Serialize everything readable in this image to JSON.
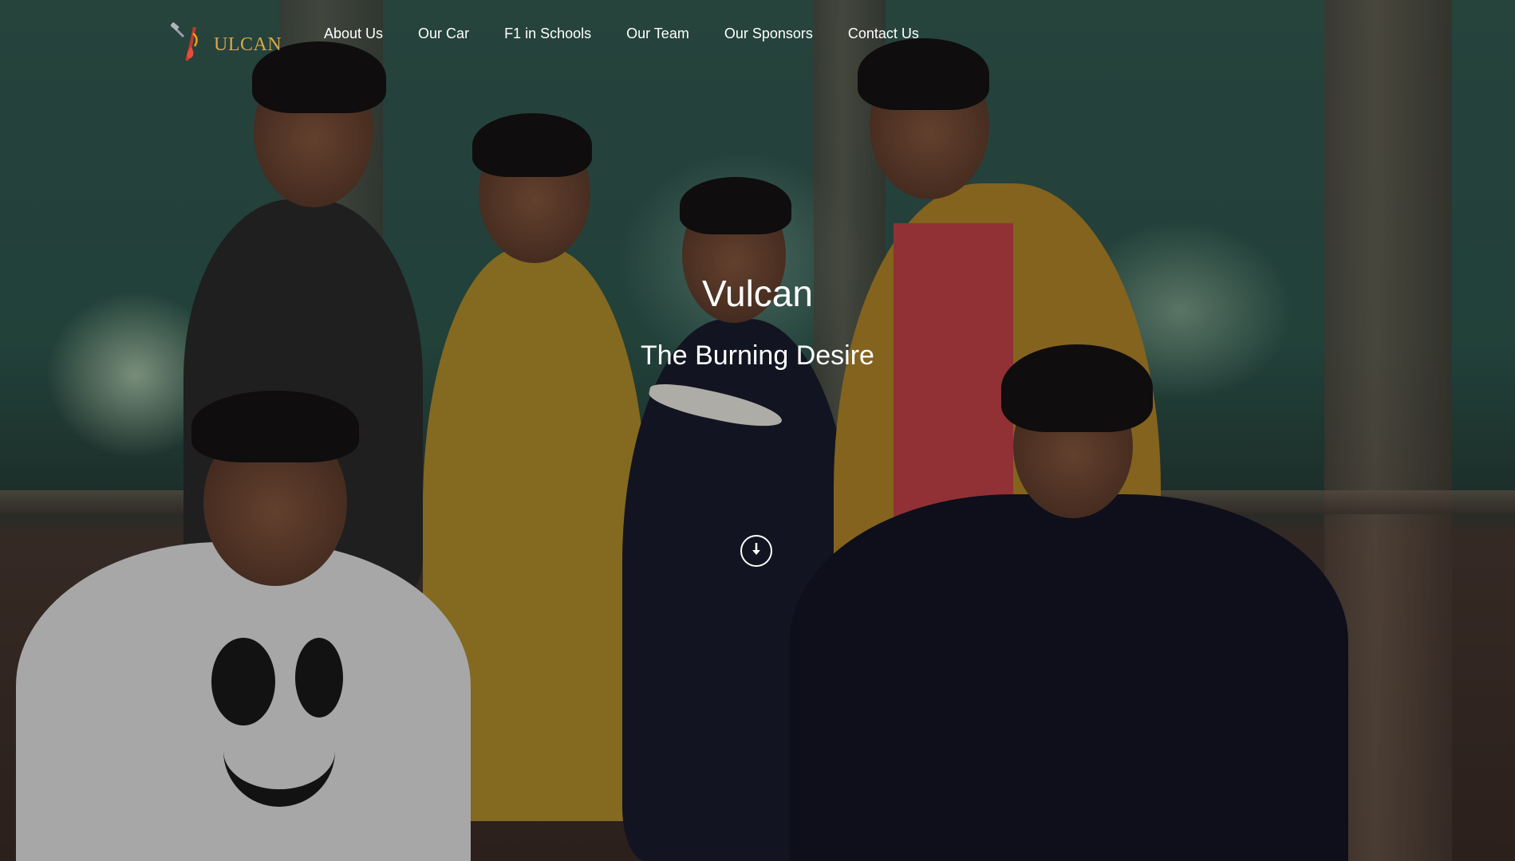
{
  "brand": {
    "logo_text": "ULCAN",
    "logo_alt_icon": "vulcan-logo-icon",
    "accent_color": "#d9a744"
  },
  "nav": {
    "items": [
      {
        "label": "About Us"
      },
      {
        "label": "Our Car"
      },
      {
        "label": "F1 in Schools"
      },
      {
        "label": "Our Team"
      },
      {
        "label": "Our Sponsors"
      },
      {
        "label": "Contact Us"
      }
    ]
  },
  "hero": {
    "title": "Vulcan",
    "subtitle": "The Burning Desire",
    "scroll_icon": "arrow-down-circle-icon",
    "background_image": "team-photo"
  }
}
